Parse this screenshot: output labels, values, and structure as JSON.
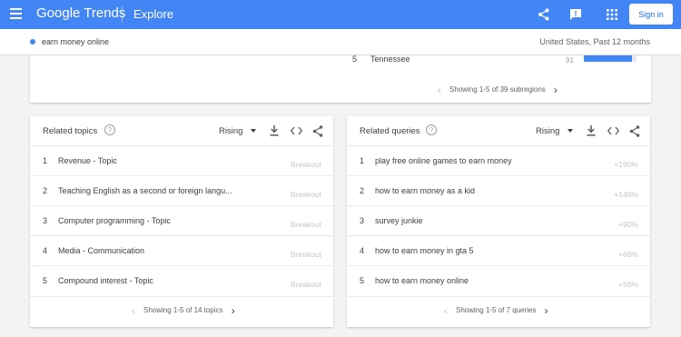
{
  "header": {
    "brand": "Google Trends",
    "page": "Explore",
    "signin_label": "Sign in",
    "colors": {
      "bar": "#4285f4",
      "accent": "#1a73e8"
    },
    "icons": [
      "menu-icon",
      "share-icon",
      "feedback-icon",
      "apps-icon"
    ]
  },
  "subheader": {
    "term": "earn money online",
    "scope": "United States, Past 12 months"
  },
  "subregions": {
    "visible_row": {
      "rank": "5",
      "name": "Tennessee",
      "value": "91",
      "bar_fraction": 0.91
    },
    "pager": "Showing 1-5 of 39 subregions"
  },
  "related_topics": {
    "title": "Related topics",
    "filter": "Rising",
    "rows": [
      {
        "rank": "1",
        "label": "Revenue - Topic",
        "value": "Breakout"
      },
      {
        "rank": "2",
        "label": "Teaching English as a second or foreign langu...",
        "value": "Breakout"
      },
      {
        "rank": "3",
        "label": "Computer programming - Topic",
        "value": "Breakout"
      },
      {
        "rank": "4",
        "label": "Media - Communication",
        "value": "Breakout"
      },
      {
        "rank": "5",
        "label": "Compound interest - Topic",
        "value": "Breakout"
      }
    ],
    "pager": "Showing 1-5 of 14 topics"
  },
  "related_queries": {
    "title": "Related queries",
    "filter": "Rising",
    "rows": [
      {
        "rank": "1",
        "label": "play free online games to earn money",
        "value": "+190%"
      },
      {
        "rank": "2",
        "label": "how to earn money as a kid",
        "value": "+140%"
      },
      {
        "rank": "3",
        "label": "survey junkie",
        "value": "+90%"
      },
      {
        "rank": "4",
        "label": "how to earn money in gta 5",
        "value": "+60%"
      },
      {
        "rank": "5",
        "label": "how to earn money online",
        "value": "+50%"
      }
    ],
    "pager": "Showing 1-5 of 7 queries"
  }
}
